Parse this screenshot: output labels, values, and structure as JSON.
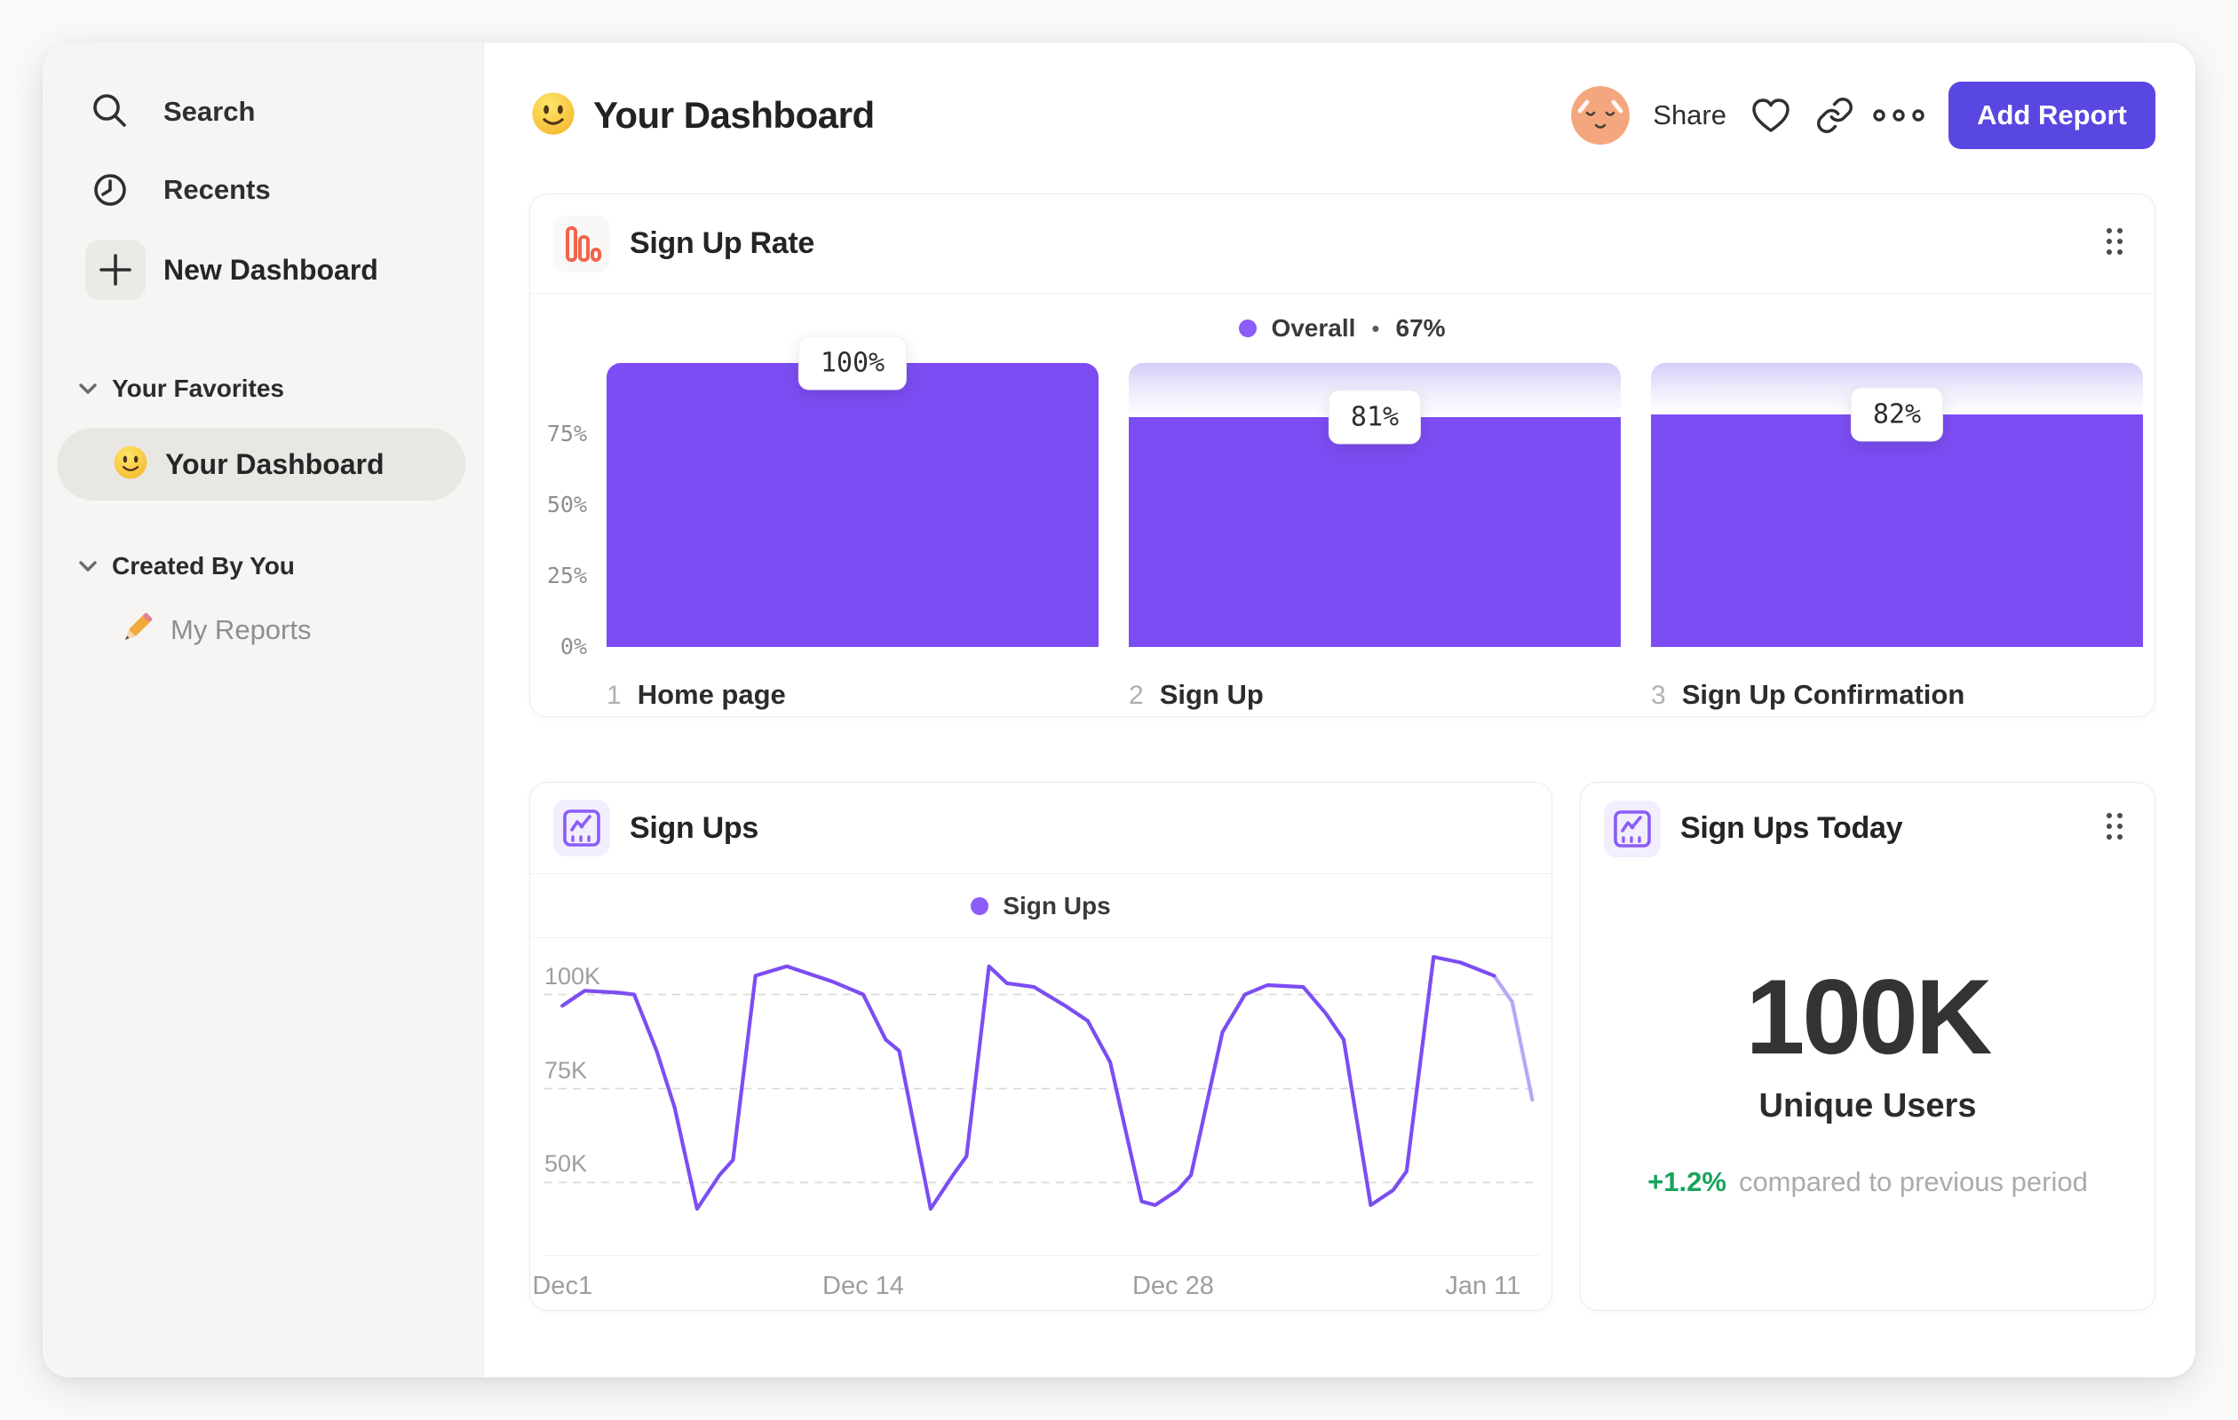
{
  "header": {
    "title": "Your Dashboard",
    "share_label": "Share",
    "add_report_label": "Add Report"
  },
  "sidebar": {
    "items": [
      {
        "label": "Search",
        "icon": "search-icon"
      },
      {
        "label": "Recents",
        "icon": "clock-icon"
      },
      {
        "label": "New Dashboard",
        "icon": "plus-icon"
      }
    ],
    "sections": [
      {
        "title": "Your Favorites",
        "items": [
          {
            "label": "Your Dashboard",
            "icon": "smiley-emoji",
            "active": true
          }
        ]
      },
      {
        "title": "Created By You",
        "items": [
          {
            "label": "My Reports",
            "icon": "pencil-emoji",
            "active": false
          }
        ]
      }
    ]
  },
  "colors": {
    "accent": "#7C4DF2",
    "accent_faded": "#B9A6F7",
    "legend_dot": "#8B5CF6",
    "button": "#5847E1",
    "green": "#17A45C",
    "orange_icon": "#F0654A",
    "gridline": "#D9D9D9"
  },
  "chart_data": [
    {
      "type": "bar",
      "title": "Sign Up Rate",
      "legend_label": "Overall",
      "legend_sep": "•",
      "legend_value": "67%",
      "ylim": [
        0,
        100
      ],
      "grid": false,
      "y_ticks": [
        {
          "label": "75%",
          "value": 75
        },
        {
          "label": "50%",
          "value": 50
        },
        {
          "label": "25%",
          "value": 25
        },
        {
          "label": "0%",
          "value": 0
        }
      ],
      "bars": [
        {
          "index": "1",
          "category": "Home page",
          "value": 100,
          "label": "100%"
        },
        {
          "index": "2",
          "category": "Sign Up",
          "value": 81,
          "label": "81%"
        },
        {
          "index": "3",
          "category": "Sign Up Confirmation",
          "value": 82,
          "label": "82%"
        }
      ]
    },
    {
      "type": "line",
      "title": "Sign Ups",
      "legend_label": "Sign Ups",
      "xlabel": "",
      "ylabel": "",
      "x_unit": "days since Dec 1",
      "xlim": [
        -0.8,
        43.5
      ],
      "ylim_k": [
        31,
        115
      ],
      "grid": "dashed-horizontal",
      "y_ticks": [
        {
          "label": "100K",
          "value": 100
        },
        {
          "label": "75K",
          "value": 75
        },
        {
          "label": "50K",
          "value": 50
        }
      ],
      "x_ticks": [
        {
          "label": "Dec1",
          "day": 0
        },
        {
          "label": "Dec 14",
          "day": 13.4
        },
        {
          "label": "Dec 28",
          "day": 27.2
        },
        {
          "label": "Jan 11",
          "day": 41
        }
      ],
      "points_k": [
        [
          0,
          97
        ],
        [
          1,
          101
        ],
        [
          2.5,
          100.5
        ],
        [
          3.2,
          100
        ],
        [
          4.2,
          85
        ],
        [
          5,
          70
        ],
        [
          6,
          43
        ],
        [
          7,
          52
        ],
        [
          7.6,
          56
        ],
        [
          8.6,
          105
        ],
        [
          10,
          107.5
        ],
        [
          12,
          103.5
        ],
        [
          13.4,
          100
        ],
        [
          14.4,
          88
        ],
        [
          15,
          85
        ],
        [
          16.4,
          43
        ],
        [
          17.4,
          52
        ],
        [
          18,
          57
        ],
        [
          19,
          107.5
        ],
        [
          19.8,
          103
        ],
        [
          21,
          102
        ],
        [
          22.4,
          97
        ],
        [
          23.4,
          93
        ],
        [
          24.4,
          82
        ],
        [
          25.8,
          45
        ],
        [
          26.4,
          44
        ],
        [
          27.4,
          48
        ],
        [
          28,
          52
        ],
        [
          29.4,
          90
        ],
        [
          30.4,
          100
        ],
        [
          31.4,
          102.5
        ],
        [
          33,
          102
        ],
        [
          34,
          95
        ],
        [
          34.8,
          88
        ],
        [
          36,
          44
        ],
        [
          37,
          48
        ],
        [
          37.6,
          53
        ],
        [
          38.8,
          110
        ],
        [
          40,
          108.5
        ],
        [
          41.5,
          105
        ]
      ],
      "faded_points_k": [
        [
          41.5,
          105
        ],
        [
          42.3,
          98
        ],
        [
          43.2,
          72
        ]
      ]
    },
    {
      "type": "kpi",
      "title": "Sign Ups Today",
      "value": "100K",
      "label": "Unique Users",
      "delta": "+1.2%",
      "note": "compared to previous period"
    }
  ]
}
